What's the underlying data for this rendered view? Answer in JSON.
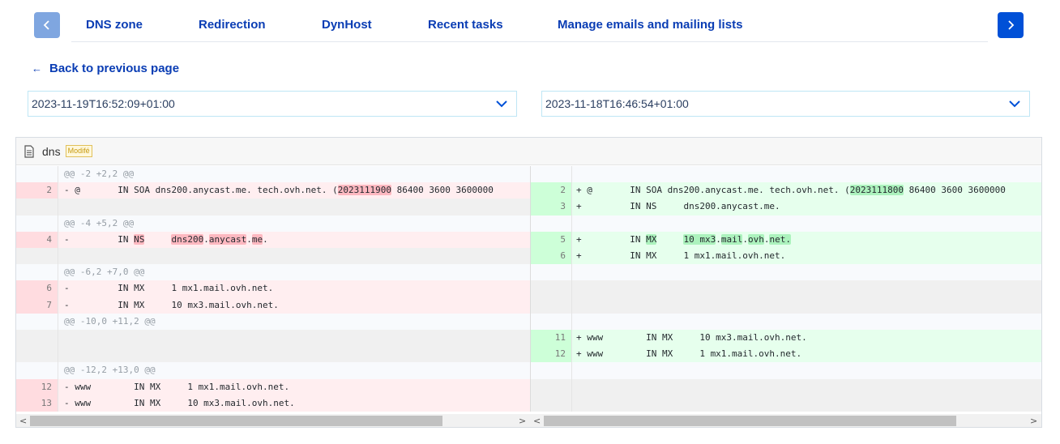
{
  "tabs": [
    "DNS zone",
    "Redirection",
    "DynHost",
    "Recent tasks",
    "Manage emails and mailing lists"
  ],
  "back_link": "Back to previous page",
  "selects": {
    "left": "2023-11-19T16:52:09+01:00",
    "right": "2023-11-18T16:46:54+01:00"
  },
  "file": {
    "name": "dns",
    "badge": "Modifé"
  },
  "diff": {
    "hunks": [
      "@@ -2 +2,2 @@",
      "@@ -4 +5,2 @@",
      "@@ -6,2 +7,0 @@",
      "@@ -10,0 +11,2 @@",
      "@@ -12,2 +13,0 @@"
    ],
    "left_nums": [
      "2",
      "4",
      "6",
      "7",
      "12",
      "13"
    ],
    "right_nums": [
      "2",
      "3",
      "5",
      "6",
      "11",
      "12"
    ],
    "left_lines": [
      "- @       IN SOA dns200.anycast.me. tech.ovh.net. (",
      "2023111900",
      " 86400 3600 3600000",
      "-         IN ",
      "NS",
      "     ",
      "dns200",
      "anycast",
      "me",
      "-         IN MX     1 mx1.mail.ovh.net.",
      "-         IN MX     10 mx3.mail.ovh.net.",
      "- www        IN MX     1 mx1.mail.ovh.net.",
      "- www        IN MX     10 mx3.mail.ovh.net."
    ],
    "right_lines": [
      "+ @       IN SOA dns200.anycast.me. tech.ovh.net. (",
      "2023111800",
      " 86400 3600 3600000",
      "+         IN NS     dns200.anycast.me.",
      "+         IN ",
      "MX",
      "     ",
      "10 mx3",
      "mail",
      "ovh",
      "net.",
      "+         IN MX     1 mx1.mail.ovh.net.",
      "+ www        IN MX     10 mx3.mail.ovh.net.",
      "+ www        IN MX     1 mx1.mail.ovh.net."
    ]
  },
  "colors": {
    "accent": "#0050d7",
    "deleted": "#ffeef0",
    "added": "#e6ffed"
  },
  "icons": [
    "chevron-left-icon",
    "chevron-right-icon",
    "arrow-left-icon",
    "chevron-down-icon",
    "file-icon"
  ]
}
